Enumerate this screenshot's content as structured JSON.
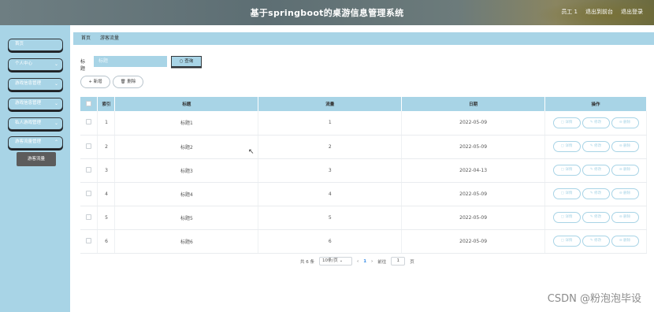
{
  "header": {
    "title": "基于springboot的桌游信息管理系统",
    "user": "员工 1",
    "back_to_front": "退出到前台",
    "logout": "退出登录"
  },
  "sidebar": {
    "items": [
      {
        "label": "首页"
      },
      {
        "label": "个人中心"
      },
      {
        "label": "游戏信息管理"
      },
      {
        "label": "游戏信息管理"
      },
      {
        "label": "私人游戏管理"
      },
      {
        "label": "游客流量管理"
      }
    ],
    "active_sub": "游客流量"
  },
  "breadcrumb": {
    "home": "首页",
    "current": "游客流量"
  },
  "search": {
    "label": "标题",
    "placeholder": "标题",
    "button": "查询"
  },
  "actions": {
    "add": "新增",
    "delete": "删除"
  },
  "table": {
    "headers": [
      "索引",
      "标题",
      "流量",
      "日期",
      "操作"
    ],
    "rows": [
      {
        "index": "1",
        "title": "标题1",
        "flow": "1",
        "date": "2022-05-09"
      },
      {
        "index": "2",
        "title": "标题2",
        "flow": "2",
        "date": "2022-05-09"
      },
      {
        "index": "3",
        "title": "标题3",
        "flow": "3",
        "date": "2022-04-13"
      },
      {
        "index": "4",
        "title": "标题4",
        "flow": "4",
        "date": "2022-05-09"
      },
      {
        "index": "5",
        "title": "标题5",
        "flow": "5",
        "date": "2022-05-09"
      },
      {
        "index": "6",
        "title": "标题6",
        "flow": "6",
        "date": "2022-05-09"
      }
    ],
    "row_actions": {
      "detail": "详情",
      "edit": "修改",
      "delete": "删除"
    }
  },
  "pagination": {
    "total": "共 6 条",
    "page_size": "10条/页",
    "prev": "‹",
    "current": "1",
    "next": "›",
    "goto": "前往",
    "goto_value": "1",
    "page_unit": "页"
  },
  "watermark": "CSDN @粉泡泡毕设"
}
